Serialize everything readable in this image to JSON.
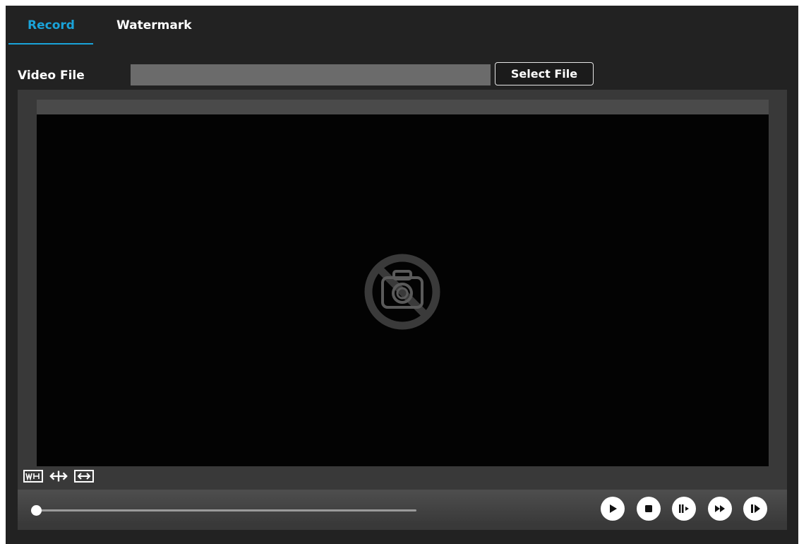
{
  "tabs": [
    {
      "label": "Record",
      "active": true
    },
    {
      "label": "Watermark",
      "active": false
    }
  ],
  "video_file": {
    "label": "Video File",
    "value": "",
    "button_label": "Select File"
  },
  "player": {
    "placeholder_icon": "no-camera-icon",
    "tools": [
      "wh-ratio-icon",
      "horizontal-stretch-icon",
      "fit-width-icon"
    ],
    "progress": 0,
    "controls": [
      "play-icon",
      "stop-icon",
      "frame-step-icon",
      "fast-forward-icon",
      "step-forward-icon"
    ]
  },
  "colors": {
    "accent": "#1aa3d9",
    "background": "#222222",
    "video_background": "#030303"
  }
}
